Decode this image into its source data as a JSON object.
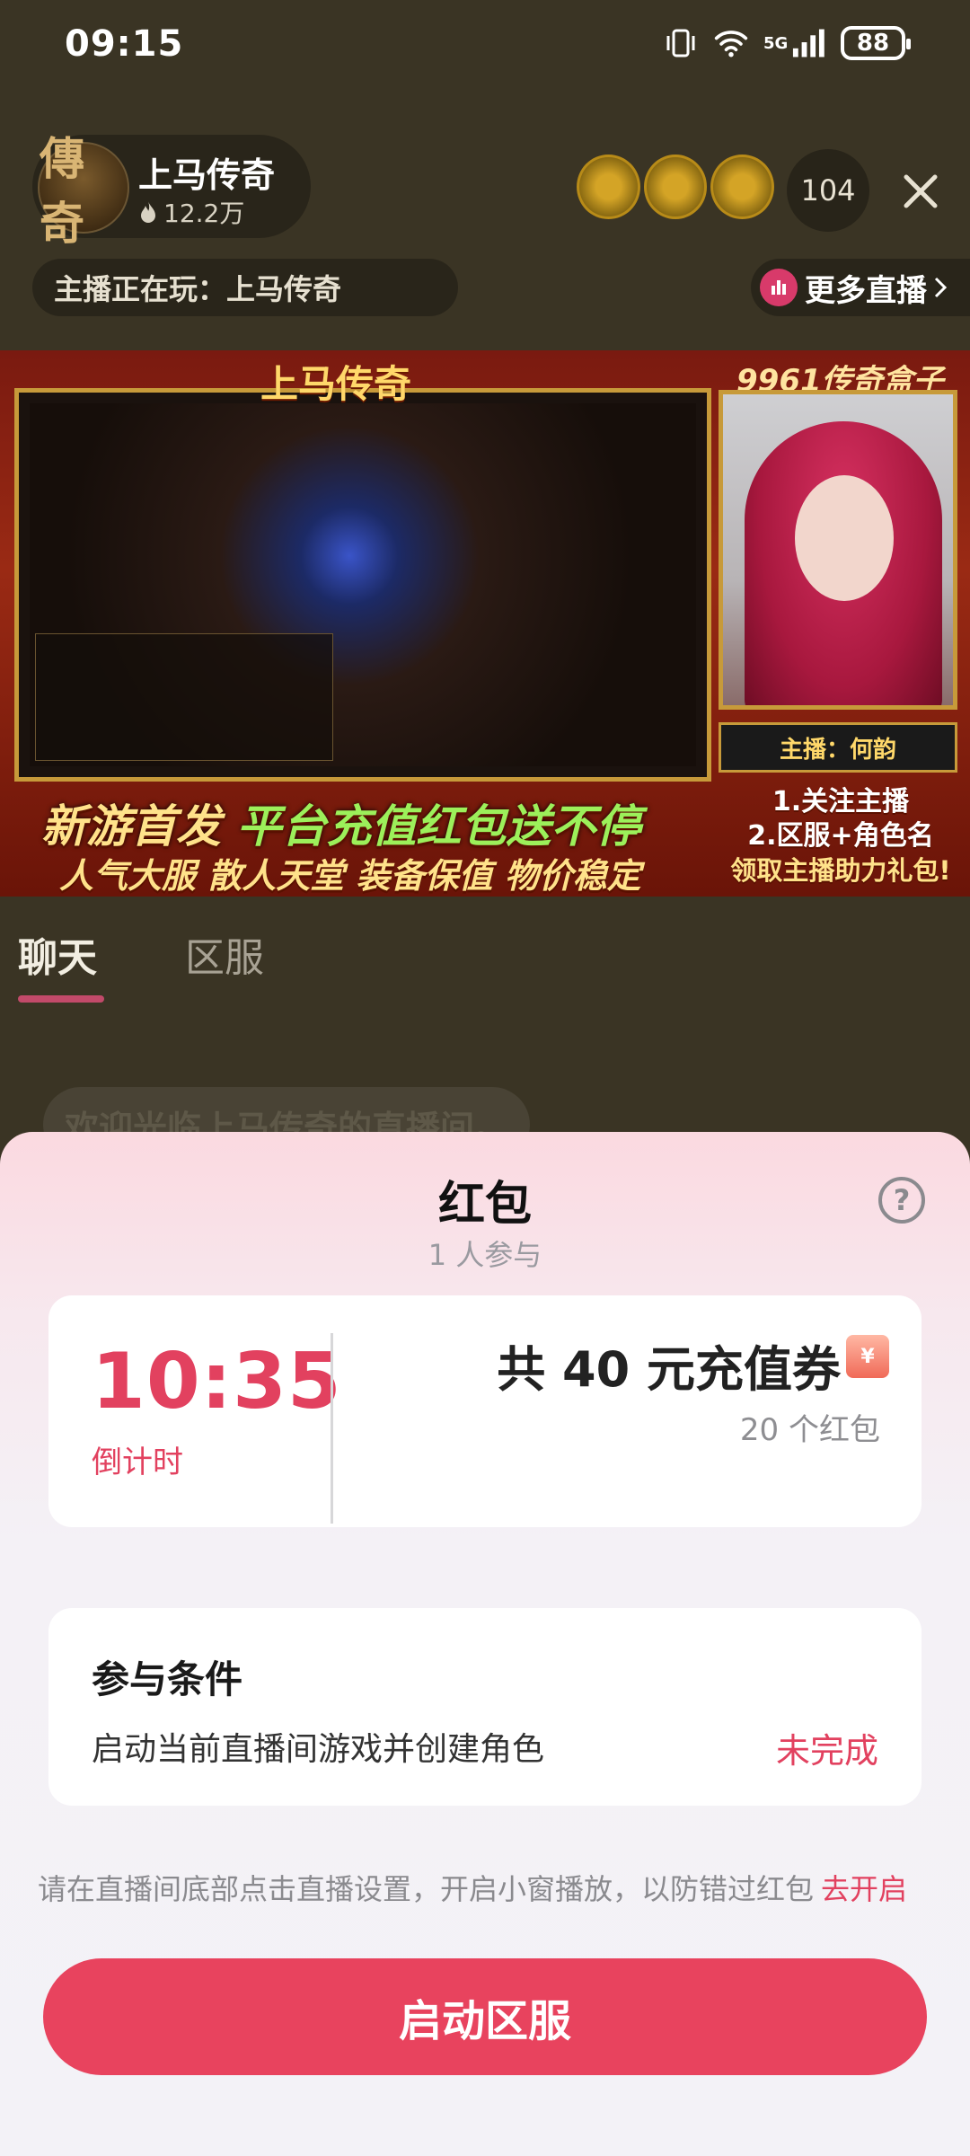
{
  "status_bar": {
    "time": "09:15",
    "network": "5G",
    "battery": "88"
  },
  "host": {
    "name": "上马传奇",
    "avatar_text": "傳奇",
    "heat": "12.2万",
    "playing": "主播正在玩：上马传奇"
  },
  "header": {
    "viewer_count": "104",
    "more_live": "更多直播"
  },
  "video": {
    "game_logo": "上马传奇",
    "box_logo": "9961传奇盒子",
    "host_plate": "主播：何韵",
    "promo_line1_a": "新游首发",
    "promo_line1_b": "平台充值红包送不停",
    "promo_line2": "人气大服 散人天堂 装备保值 物价稳定",
    "steps": [
      "1.关注主播",
      "2.区服+角色名",
      "领取主播助力礼包!"
    ]
  },
  "tabs": [
    {
      "label": "聊天"
    },
    {
      "label": "区服"
    }
  ],
  "chat": {
    "welcome": "欢迎光临上马传奇的直播间。"
  },
  "red_packet": {
    "title": "红包",
    "participants": "1 人参与",
    "countdown": "10:35",
    "countdown_label": "倒计时",
    "prize_title": "共 40 元充值券",
    "prize_count": "20 个红包",
    "condition_title": "参与条件",
    "condition_desc": "启动当前直播间游戏并创建角色",
    "condition_status": "未完成",
    "notice": "请在直播间底部点击直播设置，开启小窗播放，以防错过红包",
    "notice_link": "去开启",
    "button_label": "启动区服"
  },
  "colors": {
    "accent": "#e8435e",
    "overlay": "#3a3424"
  }
}
